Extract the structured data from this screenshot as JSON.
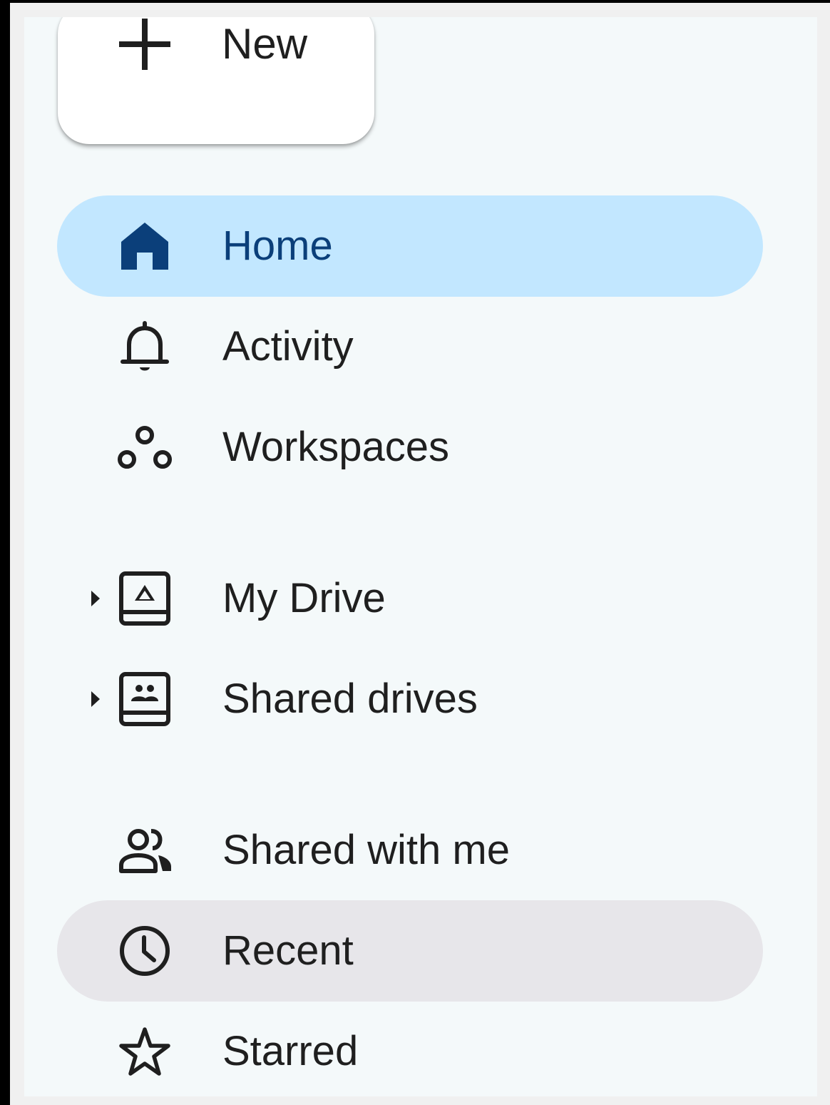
{
  "new_button": {
    "label": "New"
  },
  "nav": {
    "home": "Home",
    "activity": "Activity",
    "workspaces": "Workspaces",
    "my_drive": "My Drive",
    "shared_drives": "Shared drives",
    "shared_with_me": "Shared with me",
    "recent": "Recent",
    "starred": "Starred"
  },
  "colors": {
    "active_bg": "#c2e7ff",
    "active_text": "#0b3f7a",
    "hover_bg": "#e7e6ea",
    "sidebar_bg": "#f4f9fa",
    "text": "#1f1f1f"
  }
}
